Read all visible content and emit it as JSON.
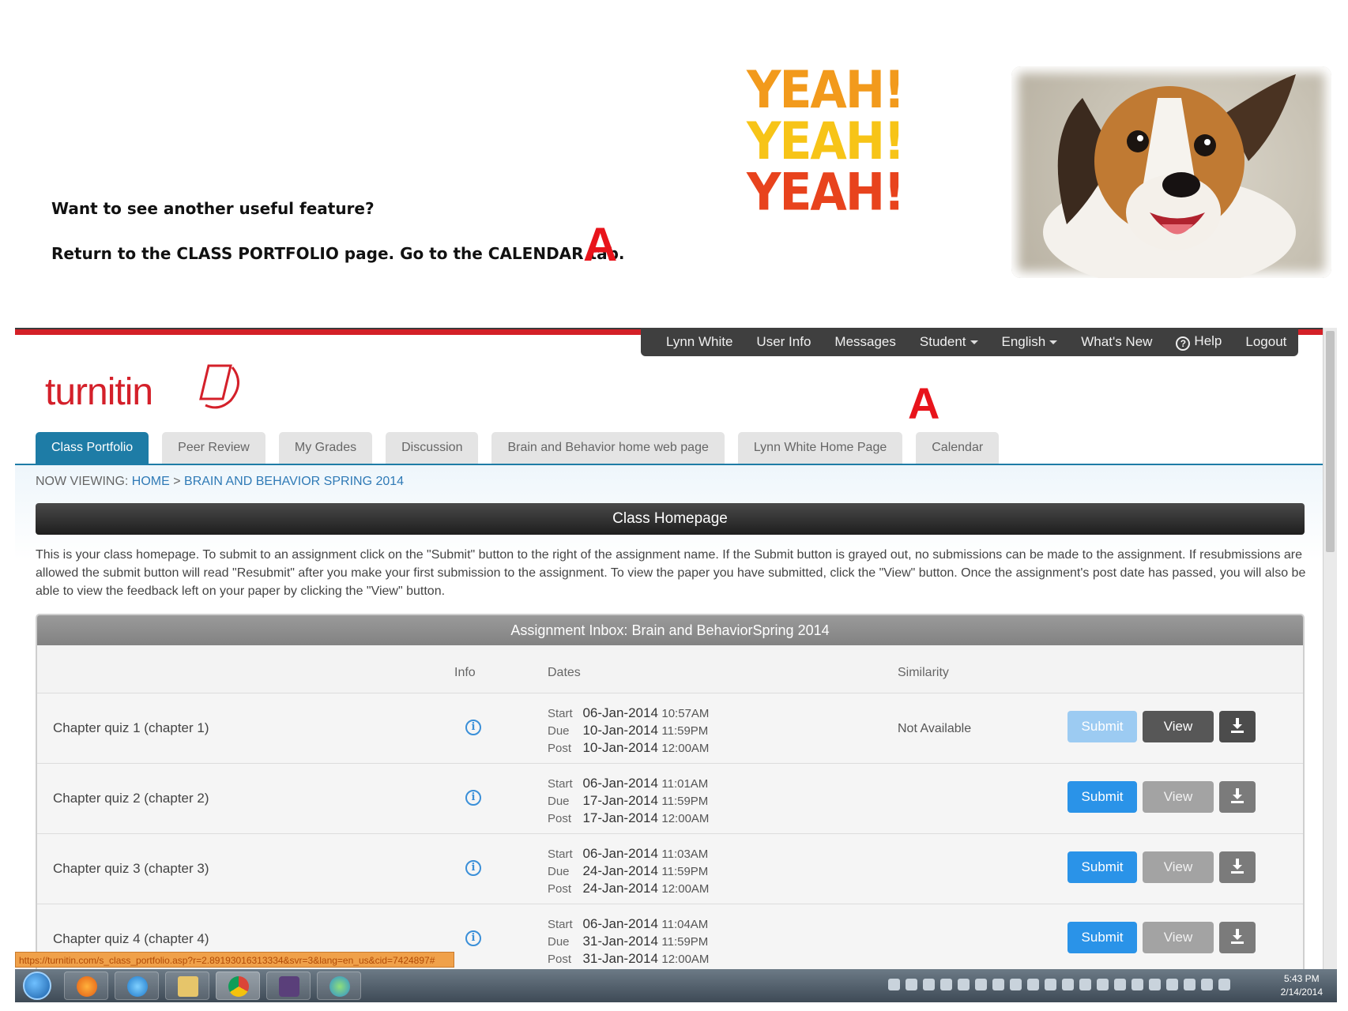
{
  "slide": {
    "line1": "Want to see another useful feature?",
    "line2": "Return to the CLASS PORTFOLIO page.  Go to the CALENDAR tab.",
    "marker": "A",
    "yeah": [
      "YEAH!",
      "YEAH!",
      "YEAH!"
    ]
  },
  "topnav": {
    "user": "Lynn White",
    "user_info": "User Info",
    "messages": "Messages",
    "role": "Student",
    "language": "English",
    "whats_new": "What's New",
    "help": "Help",
    "logout": "Logout"
  },
  "logo": {
    "text": "turnitin"
  },
  "tabs": [
    {
      "label": "Class Portfolio",
      "active": true
    },
    {
      "label": "Peer Review"
    },
    {
      "label": "My Grades"
    },
    {
      "label": "Discussion"
    },
    {
      "label": "Brain and Behavior home web page"
    },
    {
      "label": "Lynn White Home Page"
    },
    {
      "label": "Calendar"
    }
  ],
  "breadcrumb": {
    "prefix": "NOW VIEWING:",
    "home": "HOME",
    "sep": ">",
    "current": "BRAIN AND BEHAVIOR SPRING 2014"
  },
  "page_title": "Class Homepage",
  "intro": "This is your class homepage. To submit to an assignment click on the \"Submit\" button to the right of the assignment name. If the Submit button is grayed out, no submissions can be made to the assignment. If resubmissions are allowed the submit button will read \"Resubmit\" after you make your first submission to the assignment. To view the paper you have submitted, click the \"View\" button. Once the assignment's post date has passed, you will also be able to view the feedback left on your paper by clicking the \"View\" button.",
  "inbox": {
    "title": "Assignment Inbox: Brain and BehaviorSpring 2014",
    "columns": {
      "info": "Info",
      "dates": "Dates",
      "similarity": "Similarity"
    },
    "labels": {
      "start": "Start",
      "due": "Due",
      "post": "Post"
    },
    "buttons": {
      "submit": "Submit",
      "view": "View"
    },
    "rows": [
      {
        "name": "Chapter quiz 1 (chapter 1)",
        "start_date": "06-Jan-2014",
        "start_time": "10:57AM",
        "due_date": "10-Jan-2014",
        "due_time": "11:59PM",
        "post_date": "10-Jan-2014",
        "post_time": "12:00AM",
        "similarity": "Not Available"
      },
      {
        "name": "Chapter quiz 2 (chapter 2)",
        "start_date": "06-Jan-2014",
        "start_time": "11:01AM",
        "due_date": "17-Jan-2014",
        "due_time": "11:59PM",
        "post_date": "17-Jan-2014",
        "post_time": "12:00AM",
        "similarity": ""
      },
      {
        "name": "Chapter quiz 3 (chapter 3)",
        "start_date": "06-Jan-2014",
        "start_time": "11:03AM",
        "due_date": "24-Jan-2014",
        "due_time": "11:59PM",
        "post_date": "24-Jan-2014",
        "post_time": "12:00AM",
        "similarity": ""
      },
      {
        "name": "Chapter quiz 4 (chapter 4)",
        "start_date": "06-Jan-2014",
        "start_time": "11:04AM",
        "due_date": "31-Jan-2014",
        "due_time": "11:59PM",
        "post_date": "31-Jan-2014",
        "post_time": "12:00AM",
        "similarity": ""
      }
    ]
  },
  "status_url": "https://turnitin.com/s_class_portfolio.asp?r=2.89193016313334&svr=3&lang=en_us&cid=7424897#",
  "taskbar": {
    "time": "5:43 PM",
    "date": "2/14/2014"
  },
  "colors": {
    "accent": "#1e7ca6",
    "brand_red": "#d4202a",
    "submit_blue": "#2a93e8",
    "marker_red": "#e8141b"
  }
}
